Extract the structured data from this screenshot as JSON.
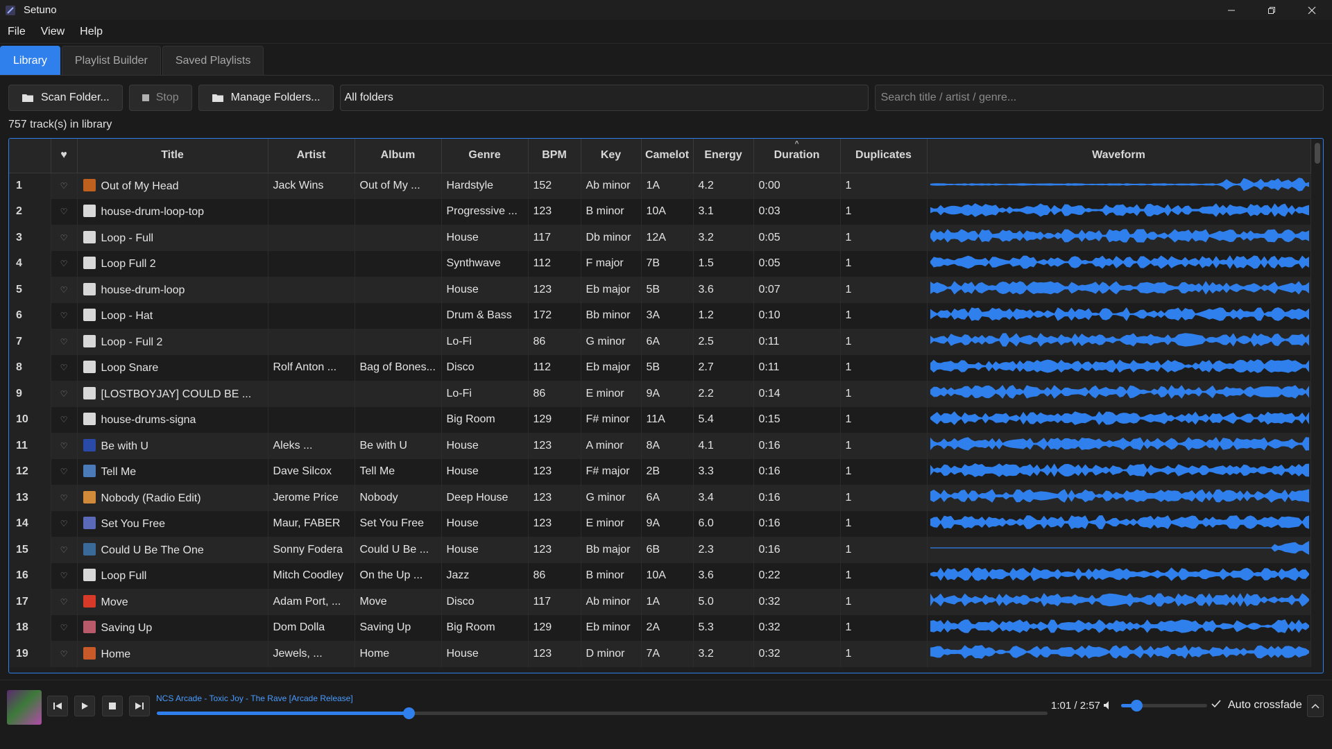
{
  "window": {
    "title": "Setuno"
  },
  "menu": [
    "File",
    "View",
    "Help"
  ],
  "tabs": [
    {
      "label": "Library",
      "active": true
    },
    {
      "label": "Playlist Builder",
      "active": false
    },
    {
      "label": "Saved Playlists",
      "active": false
    }
  ],
  "toolbar": {
    "scan_label": "Scan Folder...",
    "stop_label": "Stop",
    "manage_label": "Manage Folders...",
    "folder_value": "All folders",
    "search_placeholder": "Search title / artist / genre..."
  },
  "library": {
    "count_text": "757 track(s) in library"
  },
  "table": {
    "columns": [
      "",
      "♥",
      "Title",
      "Artist",
      "Album",
      "Genre",
      "BPM",
      "Key",
      "Camelot",
      "Energy",
      "Duration",
      "Duplicates",
      "Waveform"
    ],
    "sorted_column": "Duration",
    "rows": [
      {
        "n": "1",
        "fav": "♡",
        "thumb": "#c0601e",
        "title": "Out of My Head",
        "artist": "Jack Wins",
        "album": "Out of My ...",
        "genre": "Hardstyle",
        "bpm": "152",
        "key": "Ab minor",
        "camelot": "1A",
        "energy": "4.2",
        "duration": "0:00",
        "dups": "1"
      },
      {
        "n": "2",
        "fav": "♡",
        "thumb": "#d8d8d8",
        "title": "house-drum-loop-top",
        "artist": "",
        "album": "",
        "genre": "Progressive ...",
        "bpm": "123",
        "key": "B minor",
        "camelot": "10A",
        "energy": "3.1",
        "duration": "0:03",
        "dups": "1"
      },
      {
        "n": "3",
        "fav": "♡",
        "thumb": "#d8d8d8",
        "title": "Loop - Full",
        "artist": "",
        "album": "",
        "genre": "House",
        "bpm": "117",
        "key": "Db minor",
        "camelot": "12A",
        "energy": "3.2",
        "duration": "0:05",
        "dups": "1"
      },
      {
        "n": "4",
        "fav": "♡",
        "thumb": "#d8d8d8",
        "title": "Loop Full 2",
        "artist": "",
        "album": "",
        "genre": "Synthwave",
        "bpm": "112",
        "key": "F major",
        "camelot": "7B",
        "energy": "1.5",
        "duration": "0:05",
        "dups": "1"
      },
      {
        "n": "5",
        "fav": "♡",
        "thumb": "#d8d8d8",
        "title": "house-drum-loop",
        "artist": "",
        "album": "",
        "genre": "House",
        "bpm": "123",
        "key": "Eb major",
        "camelot": "5B",
        "energy": "3.6",
        "duration": "0:07",
        "dups": "1"
      },
      {
        "n": "6",
        "fav": "♡",
        "thumb": "#d8d8d8",
        "title": "Loop - Hat",
        "artist": "",
        "album": "",
        "genre": "Drum & Bass",
        "bpm": "172",
        "key": "Bb minor",
        "camelot": "3A",
        "energy": "1.2",
        "duration": "0:10",
        "dups": "1"
      },
      {
        "n": "7",
        "fav": "♡",
        "thumb": "#d8d8d8",
        "title": "Loop - Full 2",
        "artist": "",
        "album": "",
        "genre": "Lo-Fi",
        "bpm": "86",
        "key": "G minor",
        "camelot": "6A",
        "energy": "2.5",
        "duration": "0:11",
        "dups": "1"
      },
      {
        "n": "8",
        "fav": "♡",
        "thumb": "#d8d8d8",
        "title": "Loop Snare",
        "artist": "Rolf Anton ...",
        "album": "Bag of Bones...",
        "genre": "Disco",
        "bpm": "112",
        "key": "Eb major",
        "camelot": "5B",
        "energy": "2.7",
        "duration": "0:11",
        "dups": "1"
      },
      {
        "n": "9",
        "fav": "♡",
        "thumb": "#d8d8d8",
        "title": "[LOSTBOYJAY] COULD BE ...",
        "artist": "",
        "album": "",
        "genre": "Lo-Fi",
        "bpm": "86",
        "key": "E minor",
        "camelot": "9A",
        "energy": "2.2",
        "duration": "0:14",
        "dups": "1"
      },
      {
        "n": "10",
        "fav": "♡",
        "thumb": "#d8d8d8",
        "title": "house-drums-signa",
        "artist": "",
        "album": "",
        "genre": "Big Room",
        "bpm": "129",
        "key": "F# minor",
        "camelot": "11A",
        "energy": "5.4",
        "duration": "0:15",
        "dups": "1"
      },
      {
        "n": "11",
        "fav": "♡",
        "thumb": "#2a4aa8",
        "title": "Be with U",
        "artist": "Aleks ...",
        "album": "Be with U",
        "genre": "House",
        "bpm": "123",
        "key": "A minor",
        "camelot": "8A",
        "energy": "4.1",
        "duration": "0:16",
        "dups": "1"
      },
      {
        "n": "12",
        "fav": "♡",
        "thumb": "#4a7ab8",
        "title": "Tell Me",
        "artist": "Dave Silcox",
        "album": "Tell Me",
        "genre": "House",
        "bpm": "123",
        "key": "F# major",
        "camelot": "2B",
        "energy": "3.3",
        "duration": "0:16",
        "dups": "1"
      },
      {
        "n": "13",
        "fav": "♡",
        "thumb": "#d08a3a",
        "title": "Nobody (Radio Edit)",
        "artist": "Jerome Price",
        "album": "Nobody",
        "genre": "Deep House",
        "bpm": "123",
        "key": "G minor",
        "camelot": "6A",
        "energy": "3.4",
        "duration": "0:16",
        "dups": "1"
      },
      {
        "n": "14",
        "fav": "♡",
        "thumb": "#5a6ab8",
        "title": "Set You Free",
        "artist": "Maur, FABER",
        "album": "Set You Free",
        "genre": "House",
        "bpm": "123",
        "key": "E minor",
        "camelot": "9A",
        "energy": "6.0",
        "duration": "0:16",
        "dups": "1"
      },
      {
        "n": "15",
        "fav": "♡",
        "thumb": "#3a6a9a",
        "title": "Could U Be The One",
        "artist": "Sonny Fodera",
        "album": "Could U Be ...",
        "genre": "House",
        "bpm": "123",
        "key": "Bb major",
        "camelot": "6B",
        "energy": "2.3",
        "duration": "0:16",
        "dups": "1"
      },
      {
        "n": "16",
        "fav": "♡",
        "thumb": "#d8d8d8",
        "title": "Loop Full",
        "artist": "Mitch Coodley",
        "album": "On the Up ...",
        "genre": "Jazz",
        "bpm": "86",
        "key": "B minor",
        "camelot": "10A",
        "energy": "3.6",
        "duration": "0:22",
        "dups": "1"
      },
      {
        "n": "17",
        "fav": "♡",
        "thumb": "#d83a2a",
        "title": "Move",
        "artist": "Adam Port, ...",
        "album": "Move",
        "genre": "Disco",
        "bpm": "117",
        "key": "Ab minor",
        "camelot": "1A",
        "energy": "5.0",
        "duration": "0:32",
        "dups": "1"
      },
      {
        "n": "18",
        "fav": "♡",
        "thumb": "#b85a6a",
        "title": "Saving Up",
        "artist": "Dom Dolla",
        "album": "Saving Up",
        "genre": "Big Room",
        "bpm": "129",
        "key": "Eb minor",
        "camelot": "2A",
        "energy": "5.3",
        "duration": "0:32",
        "dups": "1"
      },
      {
        "n": "19",
        "fav": "♡",
        "thumb": "#c85a2a",
        "title": "Home",
        "artist": "Jewels, ...",
        "album": "Home",
        "genre": "House",
        "bpm": "123",
        "key": "D minor",
        "camelot": "7A",
        "energy": "3.2",
        "duration": "0:32",
        "dups": "1"
      }
    ]
  },
  "player": {
    "now_playing": "NCS Arcade - Toxic Joy - The Rave [Arcade Release]",
    "time": "1:01 / 2:57",
    "progress": 0.283,
    "volume": 0.18,
    "crossfade_label": "Auto crossfade",
    "crossfade_checked": true
  },
  "colors": {
    "accent": "#2f80ed",
    "waveform": "#2f80ed",
    "link": "#4a9cff"
  }
}
